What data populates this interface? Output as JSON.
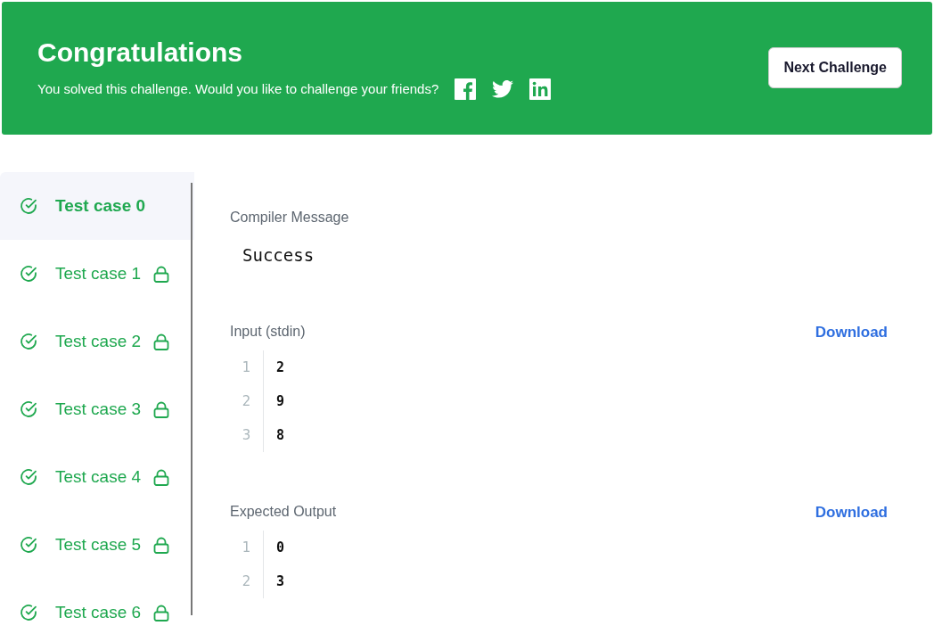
{
  "banner": {
    "title": "Congratulations",
    "message": "You solved this challenge. Would you like to challenge your friends?",
    "button": "Next Challenge"
  },
  "test_cases": [
    {
      "label": "Test case 0",
      "selected": true,
      "passed": true,
      "locked": false
    },
    {
      "label": "Test case 1",
      "selected": false,
      "passed": true,
      "locked": true
    },
    {
      "label": "Test case 2",
      "selected": false,
      "passed": true,
      "locked": true
    },
    {
      "label": "Test case 3",
      "selected": false,
      "passed": true,
      "locked": true
    },
    {
      "label": "Test case 4",
      "selected": false,
      "passed": true,
      "locked": true
    },
    {
      "label": "Test case 5",
      "selected": false,
      "passed": true,
      "locked": true
    },
    {
      "label": "Test case 6",
      "selected": false,
      "passed": true,
      "locked": true
    }
  ],
  "compiler_message": {
    "label": "Compiler Message",
    "value": "Success"
  },
  "sections": [
    {
      "label": "Input (stdin)",
      "link": "Download",
      "lines": [
        {
          "number": "1",
          "text": "2"
        },
        {
          "number": "2",
          "text": "9"
        },
        {
          "number": "3",
          "text": "8"
        }
      ]
    },
    {
      "label": "Expected Output",
      "link": "Download",
      "lines": [
        {
          "number": "1",
          "text": "0"
        },
        {
          "number": "2",
          "text": "3"
        }
      ]
    }
  ]
}
